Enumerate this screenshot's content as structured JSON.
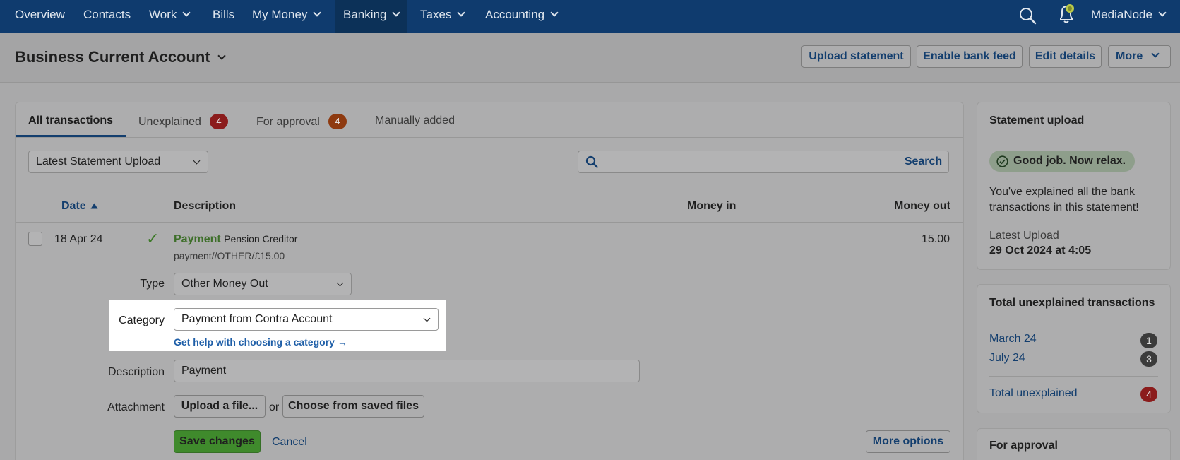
{
  "nav": {
    "items": [
      "Overview",
      "Contacts",
      "Work",
      "Bills",
      "My Money",
      "Banking",
      "Taxes",
      "Accounting"
    ],
    "account": "MediaNode"
  },
  "header": {
    "title": "Business Current Account",
    "buttons": [
      "Upload statement",
      "Enable bank feed",
      "Edit details",
      "More"
    ]
  },
  "tabs": [
    {
      "label": "All transactions",
      "badge": ""
    },
    {
      "label": "Unexplained",
      "badge": "4"
    },
    {
      "label": "For approval",
      "badge": "4"
    },
    {
      "label": "Manually added",
      "badge": ""
    }
  ],
  "filter": {
    "statement": "Latest Statement Upload",
    "search_value": "",
    "search_label": "Search"
  },
  "table": {
    "headers": {
      "date": "Date",
      "description": "Description",
      "money_in": "Money in",
      "money_out": "Money out"
    }
  },
  "transaction": {
    "date": "18 Apr 24",
    "check": "✓",
    "type_word": "Payment",
    "payee": "Pension Creditor",
    "reference": "payment//OTHER/£15.00",
    "amount_out": "15.00"
  },
  "form": {
    "type_label": "Type",
    "type_value": "Other Money Out",
    "category_label": "Category",
    "category_value": "Payment from Contra Account",
    "category_help": "Get help with choosing a category →",
    "description_label": "Description",
    "description_value": "Payment",
    "attachment_label": "Attachment",
    "upload_label": "Upload a file...",
    "or_text": "or",
    "saved_files_label": "Choose from saved files",
    "save_label": "Save changes",
    "cancel_label": "Cancel",
    "more_options_label": "More options"
  },
  "statement_upload": {
    "title": "Statement upload",
    "status": "Good job. Now relax.",
    "message": "You've explained all the bank transactions in this statement!",
    "latest_label": "Latest Upload",
    "latest_value": "29 Oct 2024 at 4:05"
  },
  "unexplained": {
    "title": "Total unexplained transactions",
    "items": [
      {
        "label": "March 24",
        "count": "1"
      },
      {
        "label": "July 24",
        "count": "3"
      }
    ],
    "total_label": "Total unexplained",
    "total_count": "4"
  },
  "approval": {
    "title": "For approval"
  },
  "colors": {
    "nav_bg": "#0f3b6e",
    "link": "#133e6e",
    "save_green": "#3f8a2c",
    "badge_red": "#8b1c1c",
    "badge_orange": "#8e3a10"
  }
}
